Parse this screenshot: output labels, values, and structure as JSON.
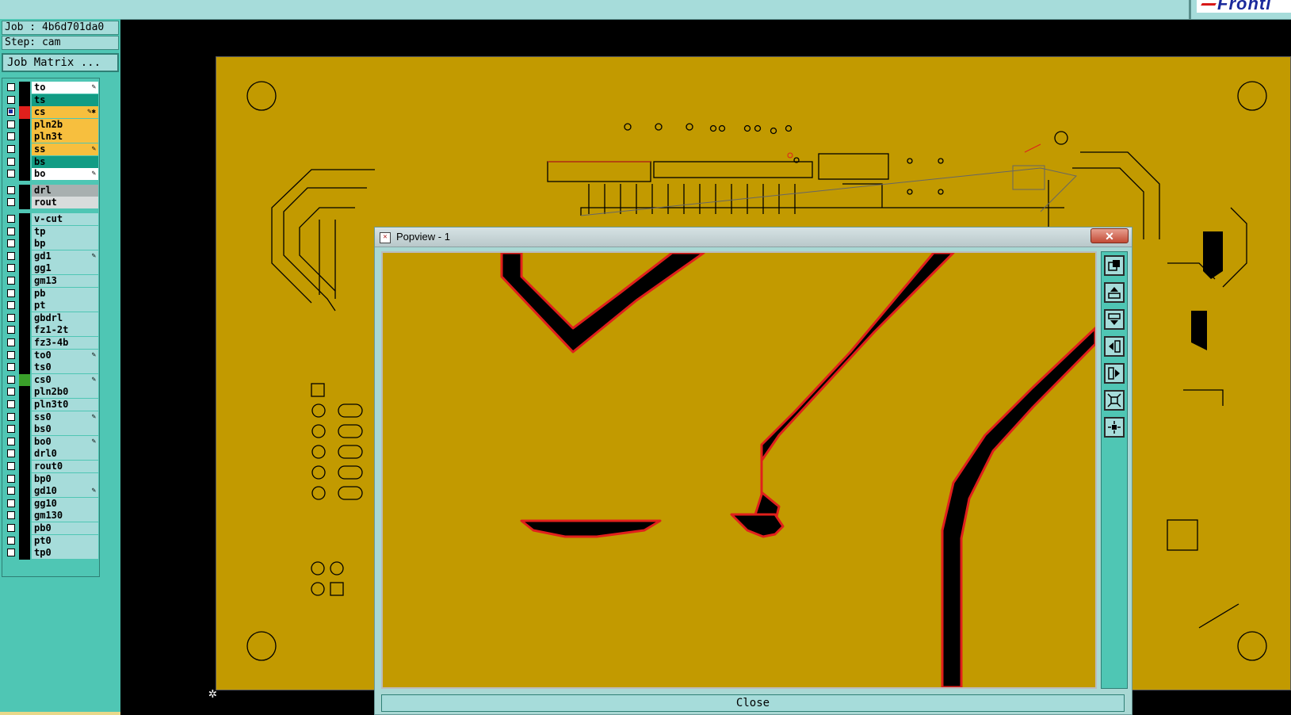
{
  "job": {
    "job_label": "Job : 4b6d701da0",
    "step_label": "Step: cam",
    "matrix_button": "Job Matrix ..."
  },
  "layers": [
    {
      "name": "to",
      "color": "#ffffff",
      "swatch": "#000000",
      "checked": false,
      "mark": "✎"
    },
    {
      "name": "ts",
      "color": "#129c84",
      "swatch": "#000000",
      "checked": false,
      "mark": ""
    },
    {
      "name": "cs",
      "color": "#f7bf3e",
      "swatch": "#e0201c",
      "checked": true,
      "mark": "✎✱"
    },
    {
      "name": "pln2b",
      "color": "#f7bf3e",
      "swatch": "#000000",
      "checked": false,
      "mark": ""
    },
    {
      "name": "pln3t",
      "color": "#f7bf3e",
      "swatch": "#000000",
      "checked": false,
      "mark": ""
    },
    {
      "name": "ss",
      "color": "#f7bf3e",
      "swatch": "#000000",
      "checked": false,
      "mark": "✎"
    },
    {
      "name": "bs",
      "color": "#129c84",
      "swatch": "#000000",
      "checked": false,
      "mark": ""
    },
    {
      "name": "bo",
      "color": "#ffffff",
      "swatch": "#000000",
      "checked": false,
      "mark": "✎"
    },
    {
      "name": "drl",
      "color": "#a8b0b0",
      "swatch": "#000000",
      "checked": false,
      "mark": "",
      "gap": true
    },
    {
      "name": "rout",
      "color": "#d8dcdc",
      "swatch": "#000000",
      "checked": false,
      "mark": ""
    },
    {
      "name": "v-cut",
      "color": "#a6dcda",
      "swatch": "#000000",
      "checked": false,
      "mark": "",
      "gap": true
    },
    {
      "name": "tp",
      "color": "#a6dcda",
      "swatch": "#000000",
      "checked": false,
      "mark": ""
    },
    {
      "name": "bp",
      "color": "#a6dcda",
      "swatch": "#000000",
      "checked": false,
      "mark": ""
    },
    {
      "name": "gd1",
      "color": "#a6dcda",
      "swatch": "#000000",
      "checked": false,
      "mark": "✎"
    },
    {
      "name": "gg1",
      "color": "#a6dcda",
      "swatch": "#000000",
      "checked": false,
      "mark": ""
    },
    {
      "name": "gm13",
      "color": "#a6dcda",
      "swatch": "#000000",
      "checked": false,
      "mark": ""
    },
    {
      "name": "pb",
      "color": "#a6dcda",
      "swatch": "#000000",
      "checked": false,
      "mark": ""
    },
    {
      "name": "pt",
      "color": "#a6dcda",
      "swatch": "#000000",
      "checked": false,
      "mark": ""
    },
    {
      "name": "gbdrl",
      "color": "#a6dcda",
      "swatch": "#000000",
      "checked": false,
      "mark": ""
    },
    {
      "name": "fz1-2t",
      "color": "#a6dcda",
      "swatch": "#000000",
      "checked": false,
      "mark": ""
    },
    {
      "name": "fz3-4b",
      "color": "#a6dcda",
      "swatch": "#000000",
      "checked": false,
      "mark": ""
    },
    {
      "name": "to0",
      "color": "#a6dcda",
      "swatch": "#000000",
      "checked": false,
      "mark": "✎"
    },
    {
      "name": "ts0",
      "color": "#a6dcda",
      "swatch": "#000000",
      "checked": false,
      "mark": ""
    },
    {
      "name": "cs0",
      "color": "#a6dcda",
      "swatch": "#3aa02a",
      "checked": false,
      "mark": "✎"
    },
    {
      "name": "pln2b0",
      "color": "#a6dcda",
      "swatch": "#000000",
      "checked": false,
      "mark": ""
    },
    {
      "name": "pln3t0",
      "color": "#a6dcda",
      "swatch": "#000000",
      "checked": false,
      "mark": ""
    },
    {
      "name": "ss0",
      "color": "#a6dcda",
      "swatch": "#000000",
      "checked": false,
      "mark": "✎"
    },
    {
      "name": "bs0",
      "color": "#a6dcda",
      "swatch": "#000000",
      "checked": false,
      "mark": ""
    },
    {
      "name": "bo0",
      "color": "#a6dcda",
      "swatch": "#000000",
      "checked": false,
      "mark": "✎"
    },
    {
      "name": "drl0",
      "color": "#a6dcda",
      "swatch": "#000000",
      "checked": false,
      "mark": ""
    },
    {
      "name": "rout0",
      "color": "#a6dcda",
      "swatch": "#000000",
      "checked": false,
      "mark": ""
    },
    {
      "name": "bp0",
      "color": "#a6dcda",
      "swatch": "#000000",
      "checked": false,
      "mark": ""
    },
    {
      "name": "gd10",
      "color": "#a6dcda",
      "swatch": "#000000",
      "checked": false,
      "mark": "✎"
    },
    {
      "name": "gg10",
      "color": "#a6dcda",
      "swatch": "#000000",
      "checked": false,
      "mark": ""
    },
    {
      "name": "gm130",
      "color": "#a6dcda",
      "swatch": "#000000",
      "checked": false,
      "mark": ""
    },
    {
      "name": "pb0",
      "color": "#a6dcda",
      "swatch": "#000000",
      "checked": false,
      "mark": ""
    },
    {
      "name": "pt0",
      "color": "#a6dcda",
      "swatch": "#000000",
      "checked": false,
      "mark": ""
    },
    {
      "name": "tp0",
      "color": "#a6dcda",
      "swatch": "#000000",
      "checked": false,
      "mark": ""
    }
  ],
  "popup": {
    "title": "Popview - 1",
    "close_x": "✕",
    "close_button": "Close"
  },
  "tools": [
    "zoom-fit-icon",
    "pan-up-icon",
    "pan-down-icon",
    "pan-left-icon",
    "pan-right-icon",
    "zoom-in-icon",
    "zoom-out-icon"
  ],
  "colors": {
    "board": "#c29a00",
    "panel": "#4fc6b4",
    "field": "#a6dcda",
    "trace_outline": "#e0201c"
  }
}
